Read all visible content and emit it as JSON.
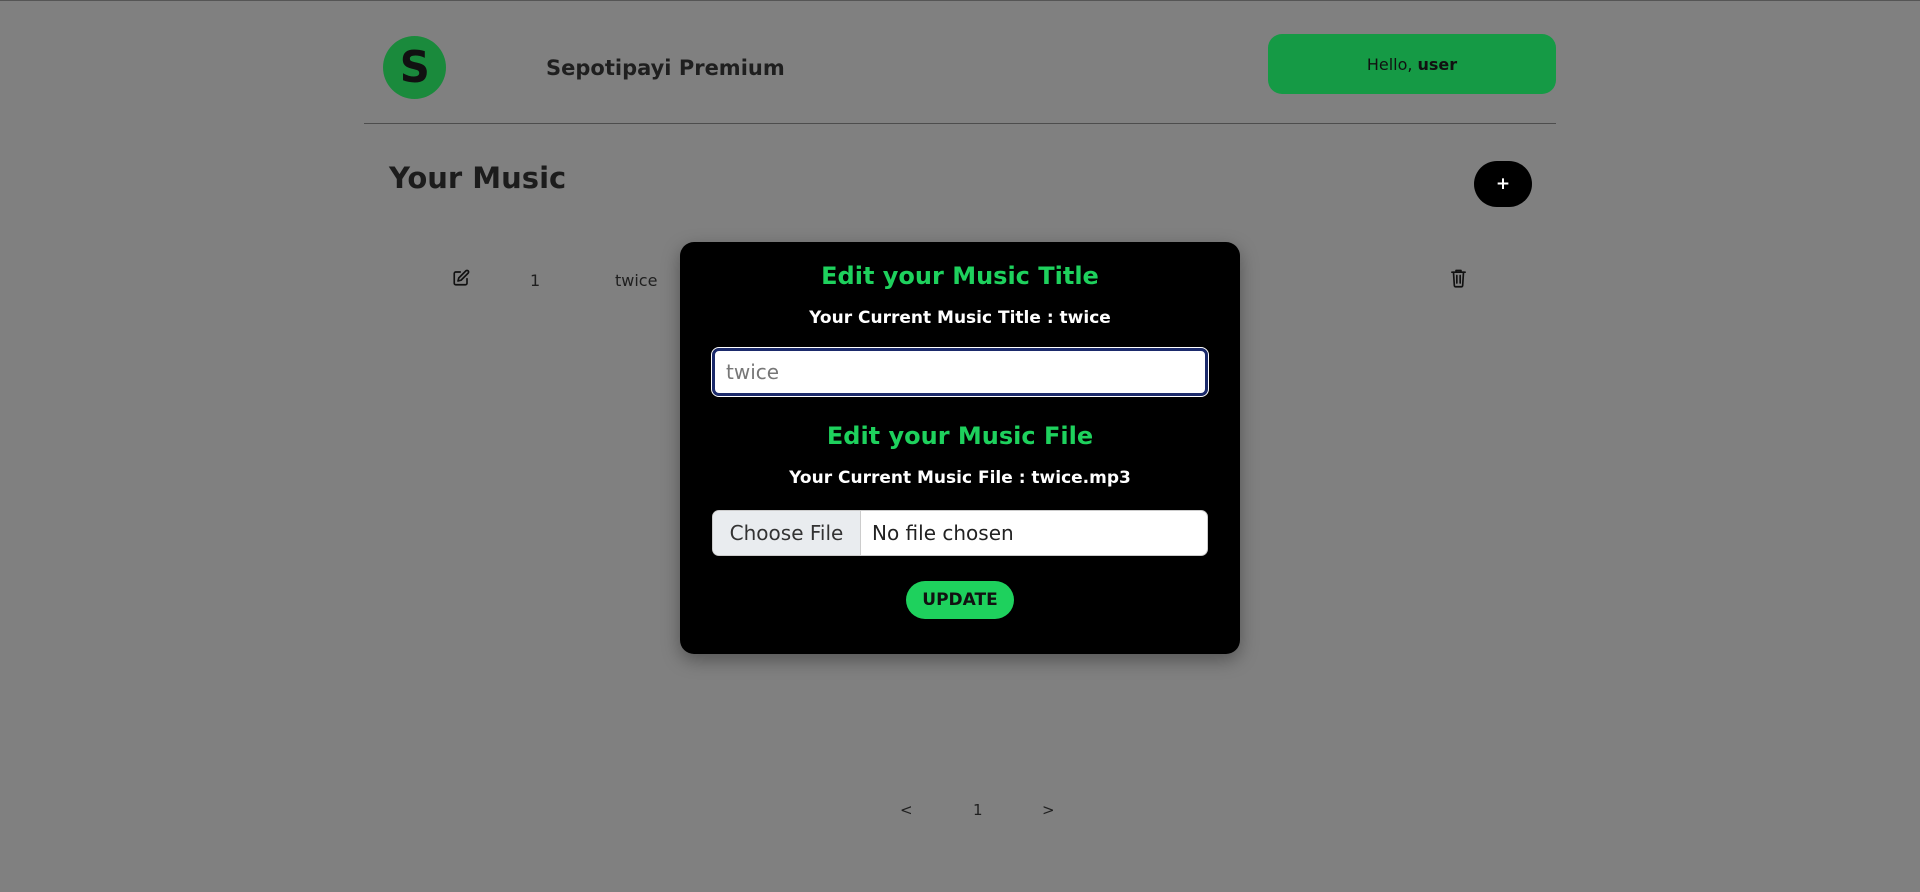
{
  "header": {
    "logo_letter": "S",
    "app_title": "Sepotipayi Premium",
    "greeting_prefix": "Hello,",
    "greeting_user": "user"
  },
  "main": {
    "section_title": "Your Music",
    "add_button_label": "+",
    "rows": [
      {
        "number": "1",
        "title": "twice"
      }
    ]
  },
  "pagination": {
    "prev": "<",
    "current": "1",
    "next": ">"
  },
  "modal": {
    "title_heading": "Edit your Music Title",
    "current_title_text": "Your Current Music Title : twice",
    "title_input_value": "",
    "title_input_placeholder": "twice",
    "file_heading": "Edit your Music File",
    "current_file_text": "Your Current Music File : twice.mp3",
    "file_button_label": "Choose File",
    "file_status": "No file chosen",
    "update_label": "UPDATE"
  },
  "colors": {
    "accent_green": "#1ed15d",
    "greeting_green": "#159a45",
    "logo_green": "#1a8a3c",
    "overlay_gray": "#808080",
    "modal_bg": "#000000"
  },
  "icons": {
    "edit": "edit-icon",
    "delete": "trash-icon"
  }
}
